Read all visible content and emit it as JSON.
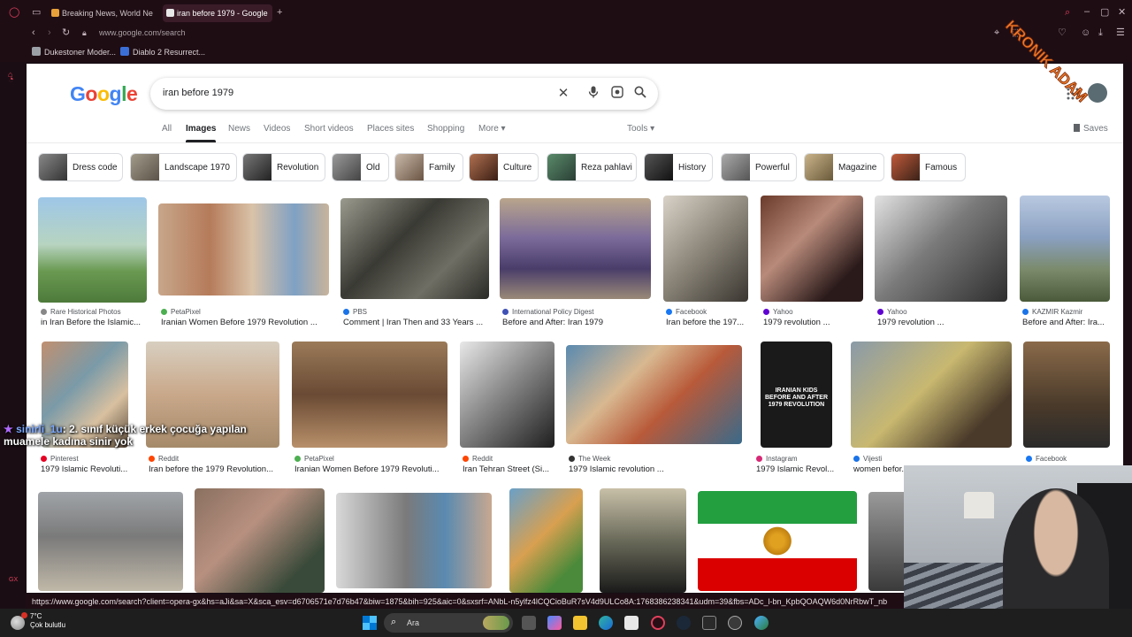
{
  "browser": {
    "tabs": [
      {
        "label": "Breaking News, World Ne",
        "color": "#e8a13a"
      },
      {
        "label": "iran before 1979 - Google",
        "color": "#e0e0e0"
      }
    ],
    "address": "www.google.com/search",
    "bookmarks": [
      {
        "label": "Dukestoner Moder...",
        "color": "#9aa0a6"
      },
      {
        "label": "Diablo 2 Resurrect...",
        "color": "#3b6fd8"
      }
    ]
  },
  "google": {
    "logo": [
      "G",
      "o",
      "o",
      "g",
      "l",
      "e"
    ],
    "logo_colors": [
      "#4285f4",
      "#ea4335",
      "#fbbc05",
      "#4285f4",
      "#34a853",
      "#ea4335"
    ],
    "query": "iran before 1979",
    "tabs": [
      "All",
      "Images",
      "News",
      "Videos",
      "Short videos",
      "Places sites",
      "Shopping",
      "More ▾"
    ],
    "active_tab": "Images",
    "tools": "Tools ▾",
    "saves": "Saves"
  },
  "chips": [
    "Dress code",
    "Landscape 1970",
    "Revolution",
    "Old",
    "Family",
    "Culture",
    "Reza pahlavi",
    "History",
    "Powerful",
    "Magazine",
    "Famous"
  ],
  "results": [
    {
      "source": "Rare Historical Photos",
      "caption": "in Iran Before the Islamic..."
    },
    {
      "source": "PetaPixel",
      "caption": "Iranian Women Before 1979 Revolution ..."
    },
    {
      "source": "PBS",
      "caption": "Comment | Iran Then and 33 Years ..."
    },
    {
      "source": "International Policy Digest",
      "caption": "Before and After: Iran 1979"
    },
    {
      "source": "Facebook",
      "caption": "Iran before the 197..."
    },
    {
      "source": "Yahoo",
      "caption": "1979 revolution ..."
    },
    {
      "source": "Yahoo",
      "caption": "1979 revolution ..."
    },
    {
      "source": "KAZMIR Kazmir",
      "caption": "Before and After: Ira..."
    },
    {
      "source": "Pinterest",
      "caption": "1979 Islamic Revoluti..."
    },
    {
      "source": "Reddit",
      "caption": "Iran before the 1979 Revolution..."
    },
    {
      "source": "PetaPixel",
      "caption": "Iranian Women Before 1979 Revoluti..."
    },
    {
      "source": "Reddit",
      "caption": "Iran Tehran Street (Si..."
    },
    {
      "source": "The Week",
      "caption": "1979 Islamic revolution ..."
    },
    {
      "source": "Instagram",
      "caption": "1979 Islamic Revol..."
    },
    {
      "source": "Vijesti",
      "caption": "women befor..."
    },
    {
      "source": "Facebook",
      "caption": ""
    }
  ],
  "overlay": {
    "status_url": "https://www.google.com/search?client=opera-gx&hs=aJi&sa=X&sca_esv=d6706571e7d76b47&biw=1875&bih=925&aic=0&sxsrf=ANbL-n5ylfz4lCQCioBuR7sV4d9ULCo8A:1768386238341&udm=39&fbs=ADc_l-bn_KpbQOAQW6d0NrRbwT_nb",
    "chat_user": "sinirli_1u",
    "chat_text": ": 2. sınıf küçük erkek çocuğa yapılan",
    "chat_line2": "muamele kadına sinir yok",
    "weather_temp": "7°C",
    "weather_desc": "Çok bulutlu",
    "taskbar_search": "Ara",
    "watermark": "KRONIK ADAM",
    "thumb_text": "IRANIAN KIDS BEFORE AND AFTER 1979 REVOLUTION"
  }
}
